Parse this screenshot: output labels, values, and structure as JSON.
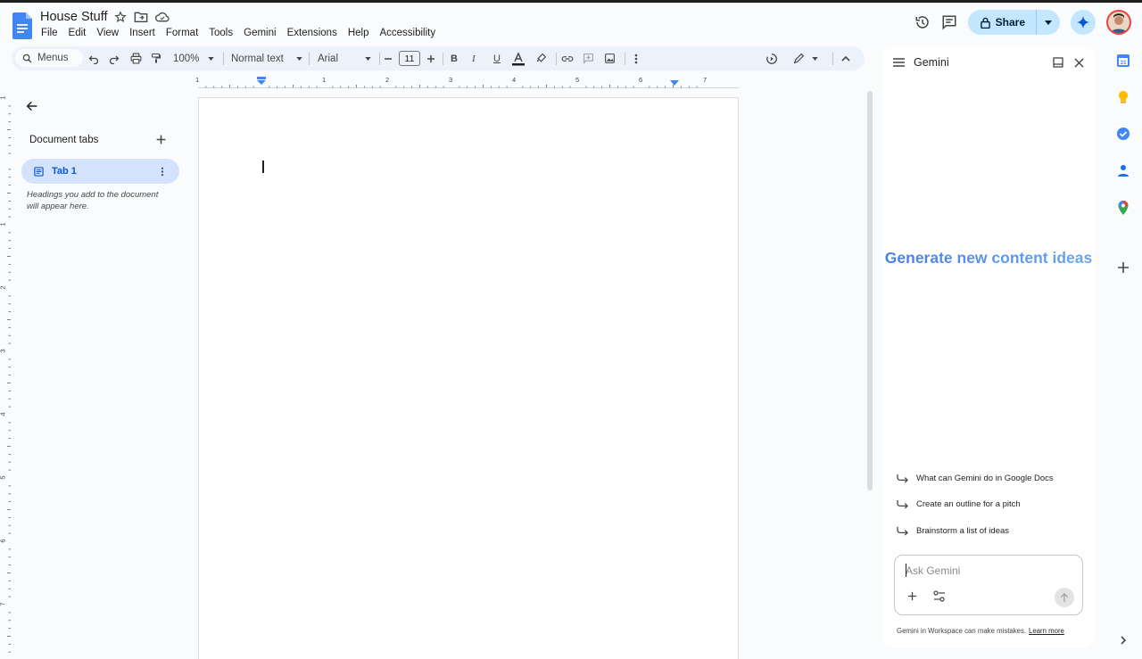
{
  "document": {
    "title": "House Stuff"
  },
  "menubar": [
    "File",
    "Edit",
    "View",
    "Insert",
    "Format",
    "Tools",
    "Gemini",
    "Extensions",
    "Help",
    "Accessibility"
  ],
  "header": {
    "share_label": "Share"
  },
  "toolbar": {
    "search_label": "Menus",
    "zoom": "100%",
    "style": "Normal text",
    "font": "Arial",
    "font_size": "11"
  },
  "ruler": {
    "horizontal": [
      "1",
      "1",
      "2",
      "3",
      "4",
      "5",
      "6",
      "7"
    ],
    "vertical": [
      "1",
      "1",
      "2",
      "3",
      "4",
      "5",
      "6",
      "7"
    ]
  },
  "outline": {
    "heading": "Document tabs",
    "tab_label": "Tab 1",
    "note": "Headings you add to the document will appear here."
  },
  "gemini": {
    "title": "Gemini",
    "hero": "Generate new content ideas",
    "suggestions": [
      "What can Gemini do in Google Docs",
      "Create an outline for a pitch",
      "Brainstorm a list of ideas"
    ],
    "input_placeholder": "Ask Gemini",
    "footer": "Gemini in Workspace can make mistakes.",
    "learn_more": "Learn more"
  },
  "side_rail": {
    "calendar_label": "31"
  },
  "colors": {
    "accent": "#0b57d0",
    "share_bg": "#c2e7ff",
    "tab_active_bg": "#d3e3fd",
    "gemini_text": "#4285f4"
  }
}
